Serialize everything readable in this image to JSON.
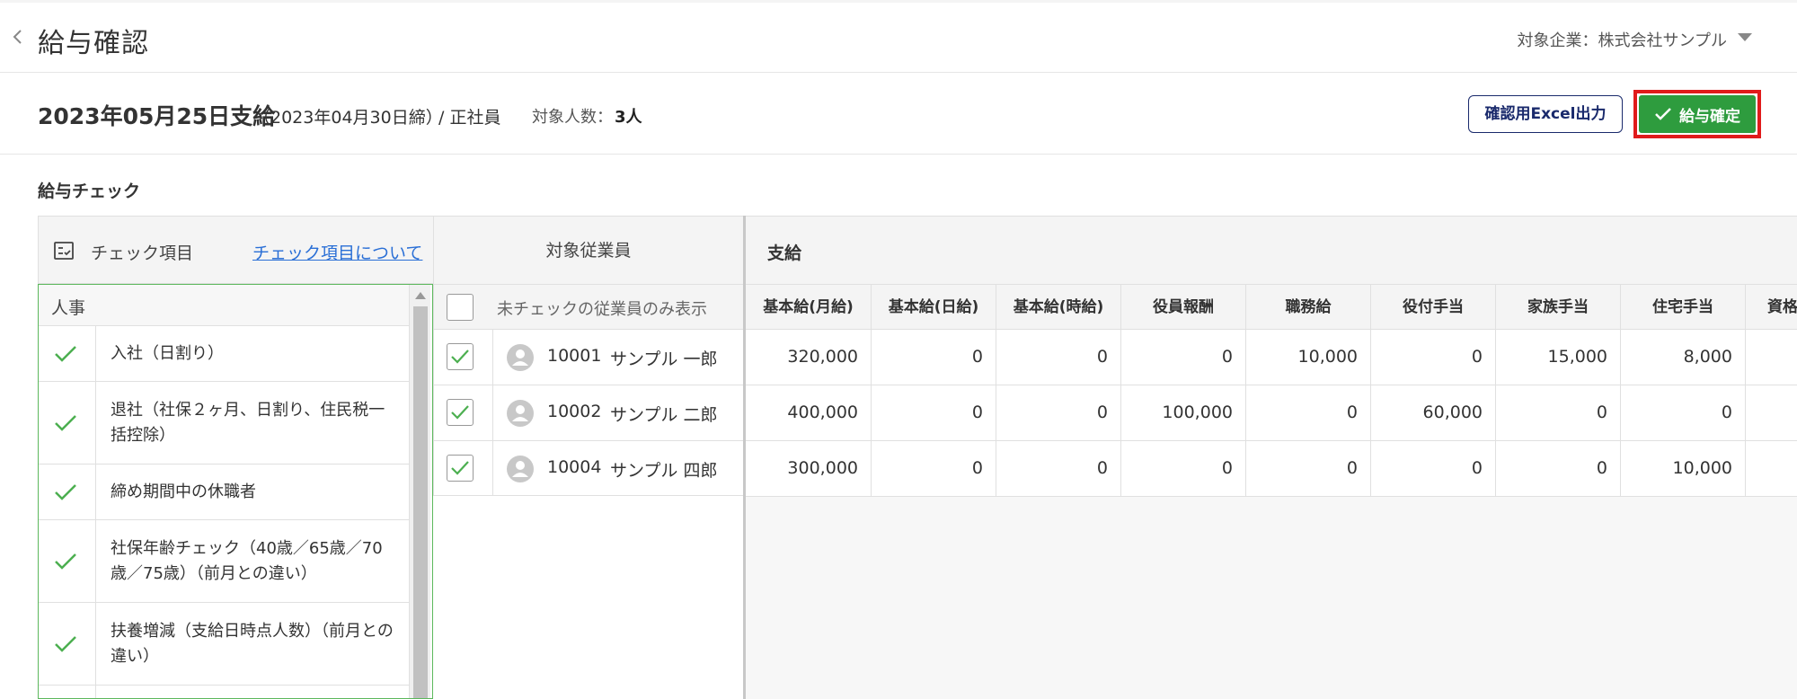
{
  "header": {
    "title": "給与確認",
    "company": "対象企業：株式会社サンプル"
  },
  "summary": {
    "pay_date": "2023年05月25日支給",
    "close_date": "（2023年04月30日締）",
    "employment_type": "/ 正社員",
    "count_label": "対象人数：",
    "count_value": "3人",
    "excel_button": "確認用Excel出力",
    "confirm_button": "給与確定"
  },
  "section_title": "給与チェック",
  "check_panel": {
    "title": "チェック項目",
    "about_link": "チェック項目について",
    "category": "人事",
    "items": [
      {
        "label": "入社（日割り）",
        "checked": true
      },
      {
        "label": "退社（社保２ヶ月、日割り、住民税一括控除）",
        "checked": true
      },
      {
        "label": "締め期間中の休職者",
        "checked": true
      },
      {
        "label": "社保年齢チェック（40歳／65歳／70歳／75歳）（前月との違い）",
        "checked": true
      },
      {
        "label": "扶養増減（支給日時点人数）（前月との違い）",
        "checked": true
      }
    ]
  },
  "employees": {
    "header": "対象従業員",
    "filter_label": "未チェックの従業員のみ表示",
    "rows": [
      {
        "code": "10001",
        "name": "サンプル 一郎",
        "checked": true
      },
      {
        "code": "10002",
        "name": "サンプル 二郎",
        "checked": true
      },
      {
        "code": "10004",
        "name": "サンプル 四郎",
        "checked": true
      }
    ]
  },
  "pay_table": {
    "group": "支給",
    "columns": [
      "基本給(月給)",
      "基本給(日給)",
      "基本給(時給)",
      "役員報酬",
      "職務給",
      "役付手当",
      "家族手当",
      "住宅手当",
      "資格手当"
    ],
    "rows": [
      [
        "320,000",
        "0",
        "0",
        "0",
        "10,000",
        "0",
        "15,000",
        "8,000",
        ""
      ],
      [
        "400,000",
        "0",
        "0",
        "100,000",
        "0",
        "60,000",
        "0",
        "0",
        ""
      ],
      [
        "300,000",
        "0",
        "0",
        "0",
        "0",
        "0",
        "0",
        "10,000",
        ""
      ]
    ]
  },
  "colors": {
    "accent_green": "#2e9c3e",
    "highlight_red": "#e01b1b",
    "link_blue": "#2a6fd6",
    "navy": "#1a2a6c"
  }
}
